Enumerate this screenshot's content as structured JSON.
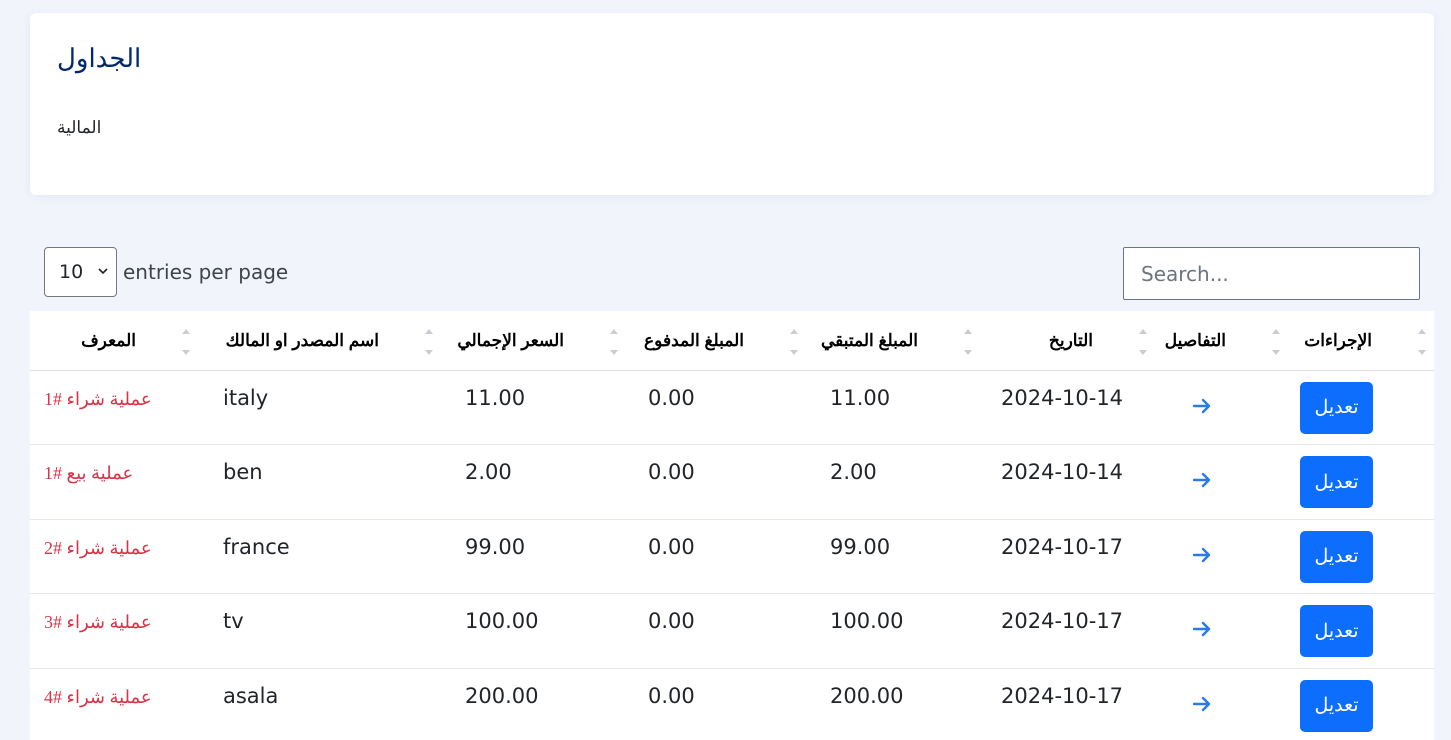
{
  "header": {
    "title": "الجداول",
    "subtitle": "المالية"
  },
  "controls": {
    "page_size": "10",
    "per_page_label": "entries per page",
    "search_placeholder": "Search..."
  },
  "table": {
    "columns": [
      "المعرف",
      "اسم المصدر او المالك",
      "السعر الإجمالي",
      "المبلغ المدفوع",
      "المبلغ المتبقي",
      "التاريخ",
      "التفاصيل",
      "الإجراءات"
    ],
    "rows": [
      {
        "id": "عملية شراء #1",
        "name": "italy",
        "total": "11.00",
        "paid": "0.00",
        "remaining": "11.00",
        "date": "2024-10-14",
        "action": "تعديل"
      },
      {
        "id": "عملية بيع #1",
        "name": "ben",
        "total": "2.00",
        "paid": "0.00",
        "remaining": "2.00",
        "date": "2024-10-14",
        "action": "تعديل"
      },
      {
        "id": "عملية شراء #2",
        "name": "france",
        "total": "99.00",
        "paid": "0.00",
        "remaining": "99.00",
        "date": "2024-10-17",
        "action": "تعديل"
      },
      {
        "id": "عملية شراء #3",
        "name": "tv",
        "total": "100.00",
        "paid": "0.00",
        "remaining": "100.00",
        "date": "2024-10-17",
        "action": "تعديل"
      },
      {
        "id": "عملية شراء #4",
        "name": "asala",
        "total": "200.00",
        "paid": "0.00",
        "remaining": "200.00",
        "date": "2024-10-17",
        "action": "تعديل"
      }
    ]
  },
  "colors": {
    "title": "#012970",
    "id_link": "#d63447",
    "button": "#0d6efd",
    "arrow": "#2a7ae4"
  },
  "icons": {
    "details": "arrow-right-icon",
    "sort": "sort-icon",
    "select": "chevron-down-icon"
  }
}
